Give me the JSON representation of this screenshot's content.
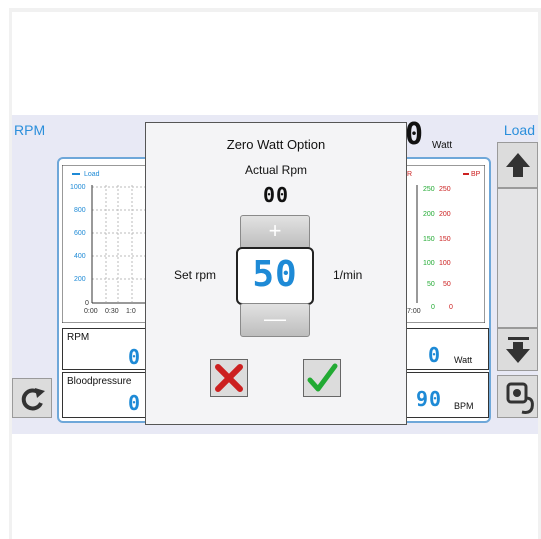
{
  "header": {
    "left_label": "RPM",
    "right_label": "Load",
    "watt_value": "0",
    "watt_unit": "Watt"
  },
  "chart_left": {
    "legend": "Load",
    "y_ticks": [
      "1000",
      "800",
      "600",
      "400",
      "200",
      "0"
    ],
    "x_ticks": [
      "0:00",
      "0:30",
      "1:0"
    ]
  },
  "chart_right": {
    "legend_a": "R",
    "legend_b": "BP",
    "hr_ticks": [
      "250",
      "200",
      "150",
      "100",
      "50",
      "0"
    ],
    "bp_ticks": [
      "250",
      "200",
      "150",
      "100",
      "50",
      "0"
    ],
    "x_tick": "7:00"
  },
  "stats": {
    "rpm_title": "RPM",
    "rpm_value": "0",
    "bp_title": "Bloodpressure",
    "bp_value": "0",
    "watt_value": "0",
    "watt_unit": "Watt",
    "bpm_value": "90",
    "bpm_unit": "BPM"
  },
  "dialog": {
    "title": "Zero Watt Option",
    "actual_label": "Actual Rpm",
    "actual_value": "00",
    "set_label": "Set rpm",
    "set_value": "50",
    "unit": "1/min",
    "plus": "+",
    "minus": "—"
  },
  "icons": {
    "up": "arrow-up-icon",
    "down": "arrow-down-icon",
    "refresh": "refresh-icon",
    "bp_device": "bp-device-icon",
    "cancel": "cancel-icon",
    "confirm": "confirm-icon"
  },
  "colors": {
    "accent": "#2b8fdb",
    "digit": "#1e8ad6",
    "cancel_red": "#cc2020",
    "confirm_green": "#22aa33"
  }
}
